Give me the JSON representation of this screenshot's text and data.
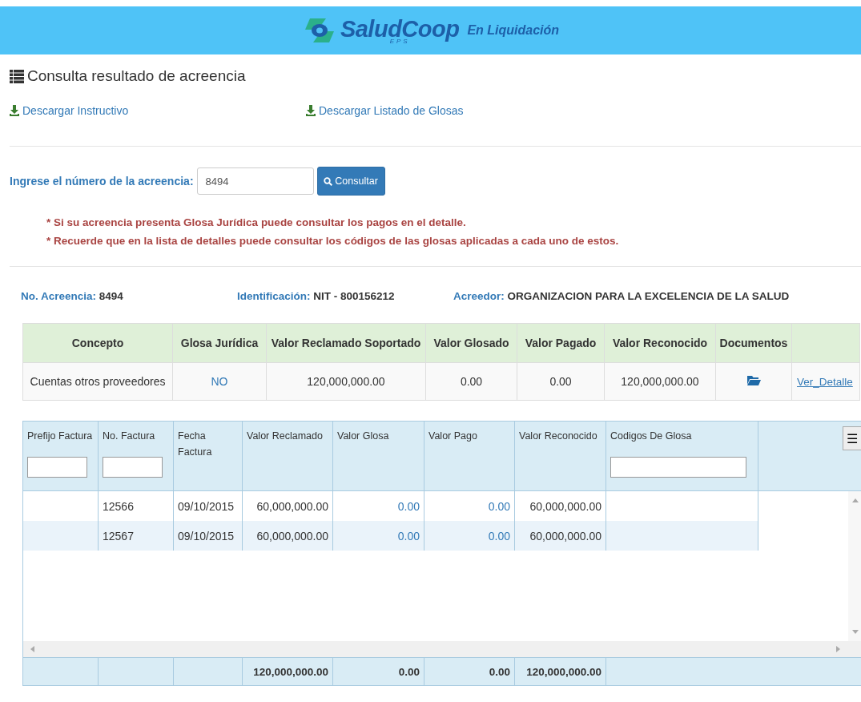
{
  "header": {
    "brand": "SaludCoop",
    "brand_sub": "EPS",
    "tagline": "En Liquidación"
  },
  "page_title": "Consulta resultado de acreencia",
  "downloads": [
    {
      "label": "Descargar Instructivo"
    },
    {
      "label": "Descargar Listado de Glosas"
    }
  ],
  "search": {
    "label": "Ingrese el número de la acreencia:",
    "value": "8494",
    "button": "Consultar"
  },
  "notes": [
    "* Si su acreencia presenta Glosa Jurídica puede consultar los pagos en el detalle.",
    "* Recuerde que en la lista de detalles puede consultar los códigos de las glosas aplicadas a cada uno de estos."
  ],
  "info": [
    {
      "label": "No. Acreencia:",
      "value": "8494"
    },
    {
      "label": "Identificación:",
      "value": "NIT - 800156212"
    },
    {
      "label": "Acreedor:",
      "value": "ORGANIZACION PARA LA EXCELENCIA DE LA SALUD"
    }
  ],
  "summary": {
    "columns": [
      "Concepto",
      "Glosa Jurídica",
      "Valor Reclamado Soportado",
      "Valor Glosado",
      "Valor Pagado",
      "Valor Reconocido",
      "Documentos"
    ],
    "rows": [
      {
        "concepto": "Cuentas otros proveedores",
        "glosa": "NO",
        "reclamado": "120,000,000.00",
        "glosado": "0.00",
        "pagado": "0.00",
        "reconocido": "120,000,000.00",
        "link": "Ver_Detalle"
      }
    ]
  },
  "detail": {
    "columns": [
      {
        "label": "Prefijo Factura",
        "filter": true
      },
      {
        "label": "No. Factura",
        "filter": true
      },
      {
        "label": "Fecha Factura",
        "filter": false
      },
      {
        "label": "Valor Reclamado",
        "filter": false
      },
      {
        "label": "Valor Glosa",
        "filter": false
      },
      {
        "label": "Valor Pago",
        "filter": false
      },
      {
        "label": "Valor Reconocido",
        "filter": false
      },
      {
        "label": "Codigos De Glosa",
        "filter": true
      }
    ],
    "menu_icon": "☰",
    "rows": [
      {
        "prefijo": "",
        "factura": "12566",
        "fecha": "09/10/2015",
        "reclamado": "60,000,000.00",
        "glosa": "0.00",
        "pago": "0.00",
        "reconocido": "60,000,000.00"
      },
      {
        "prefijo": "",
        "factura": "12567",
        "fecha": "09/10/2015",
        "reclamado": "60,000,000.00",
        "glosa": "0.00",
        "pago": "0.00",
        "reconocido": "60,000,000.00"
      }
    ],
    "totals": {
      "reclamado": "120,000,000.00",
      "glosa": "0.00",
      "pago": "0.00",
      "reconocido": "120,000,000.00"
    }
  }
}
